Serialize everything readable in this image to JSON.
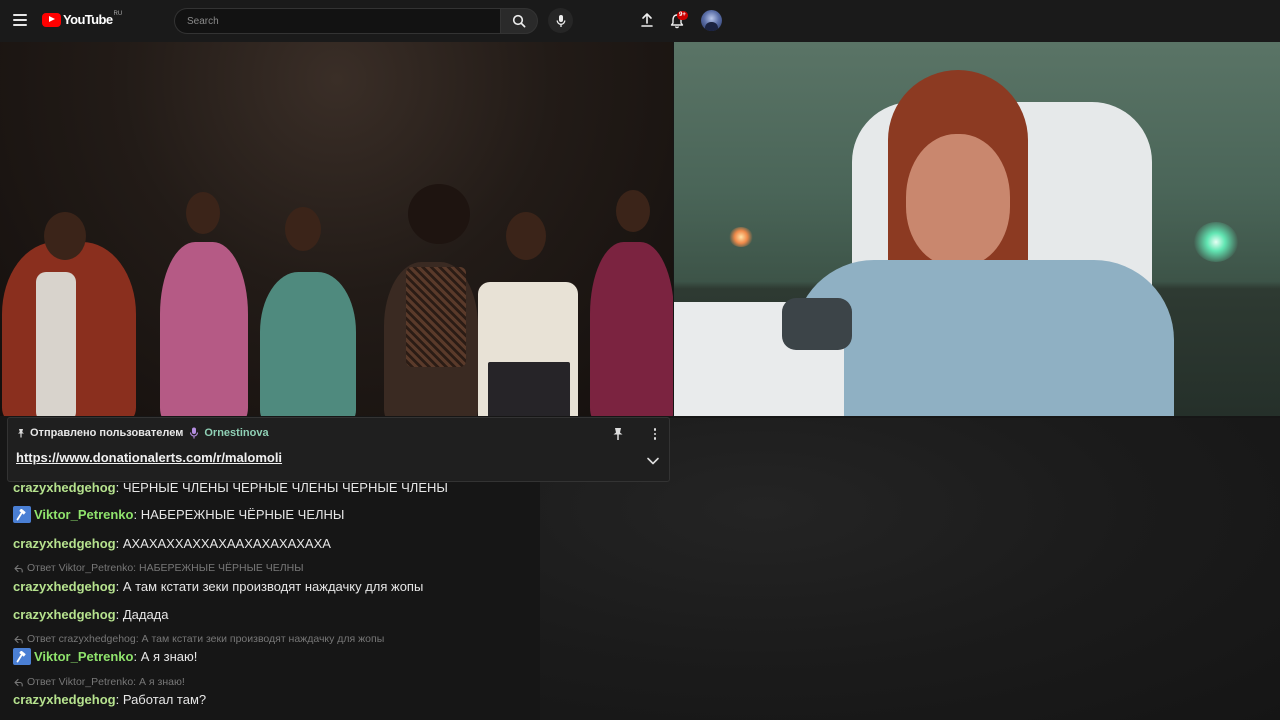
{
  "header": {
    "logo_text": "YouTube",
    "logo_region": "RU",
    "search_placeholder": "Search",
    "notifications_badge": "9+"
  },
  "pinned": {
    "pinned_by_label": "Отправлено пользователем",
    "user": "Ornestinova",
    "link": "https://www.donationalerts.com/r/malomoli"
  },
  "chat": {
    "messages": [
      {
        "author": "crazyxhedgehog",
        "text": "ЧЕРНЫЕ ЧЛЕНЫ ЧЕРНЫЕ ЧЛЕНЫ ЧЕРНЫЕ ЧЛЕНЫ",
        "moderator": false
      },
      {
        "author": "Viktor_Petrenko",
        "text": "НАБЕРЕЖНЫЕ ЧЁРНЫЕ ЧЕЛНЫ",
        "moderator": true
      },
      {
        "author": "crazyxhedgehog",
        "text": "АХАХАХХАХХАХААХАХАХАХАХА",
        "moderator": false
      },
      {
        "reply_to": "Ответ Viktor_Petrenko: НАБЕРЕЖНЫЕ ЧЁРНЫЕ ЧЕЛНЫ",
        "author": "crazyxhedgehog",
        "text": "А там кстати зеки производят наждачку для жопы",
        "moderator": false
      },
      {
        "author": "crazyxhedgehog",
        "text": "Дадада",
        "moderator": false
      },
      {
        "reply_to": "Ответ crazyxhedgehog: А там кстати зеки производят наждачку для жопы",
        "author": "Viktor_Petrenko",
        "text": "А я знаю!",
        "moderator": true
      },
      {
        "reply_to": "Ответ Viktor_Petrenko: А я знаю!",
        "author": "crazyxhedgehog",
        "text": "Работал там?",
        "moderator": false
      }
    ]
  },
  "colors": {
    "author_name": "#b6e28e",
    "moderator_badge": "#4a7fd4",
    "pinned_user": "#8fd0b5",
    "youtube_red": "#ff0000"
  }
}
